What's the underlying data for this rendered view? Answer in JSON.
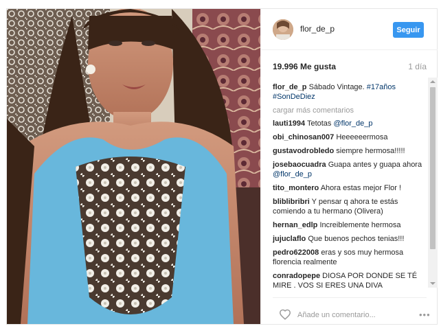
{
  "post": {
    "username": "flor_de_p",
    "follow_label": "Seguir",
    "likes": "19.996 Me gusta",
    "time": "1 día",
    "caption": {
      "username": "flor_de_p",
      "text": "Sábado Vintage.",
      "hashtag1": "#17años",
      "hashtag2": "#SonDeDiez"
    },
    "load_more": "cargar más comentarios",
    "comments": [
      {
        "user": "lauti1994",
        "text": "Tetotas",
        "mention": "@flor_de_p"
      },
      {
        "user": "obi_chinosan007",
        "text": "Heeeeeermosa"
      },
      {
        "user": "gustavodrobledo",
        "text": "siempre hermosa!!!!!"
      },
      {
        "user": "josebaocuadra",
        "text": "Guapa antes y guapa ahora",
        "mention": "@flor_de_p"
      },
      {
        "user": "tito_montero",
        "text": "Ahora estas mejor Flor !"
      },
      {
        "user": "bliblibribri",
        "text": "Y pensar q ahora te estás comiendo a tu hermano (Olivera)"
      },
      {
        "user": "hernan_edlp",
        "text": "Increiblemente hermosa"
      },
      {
        "user": "jujuclaflo",
        "text": "Que buenos pechos tenias!!!"
      },
      {
        "user": "pedro622008",
        "text": "eras y sos muy hermosa florencia realmente"
      },
      {
        "user": "conradopepe",
        "text": "DIOSA POR DONDE SE TÉ MIRE , VOS SI ERES UNA DIVA"
      }
    ],
    "add_comment_placeholder": "Añade un comentario...",
    "more_label": "•••"
  },
  "colors": {
    "follow_button": "#3897f0",
    "link": "#003569",
    "muted": "#999999"
  }
}
